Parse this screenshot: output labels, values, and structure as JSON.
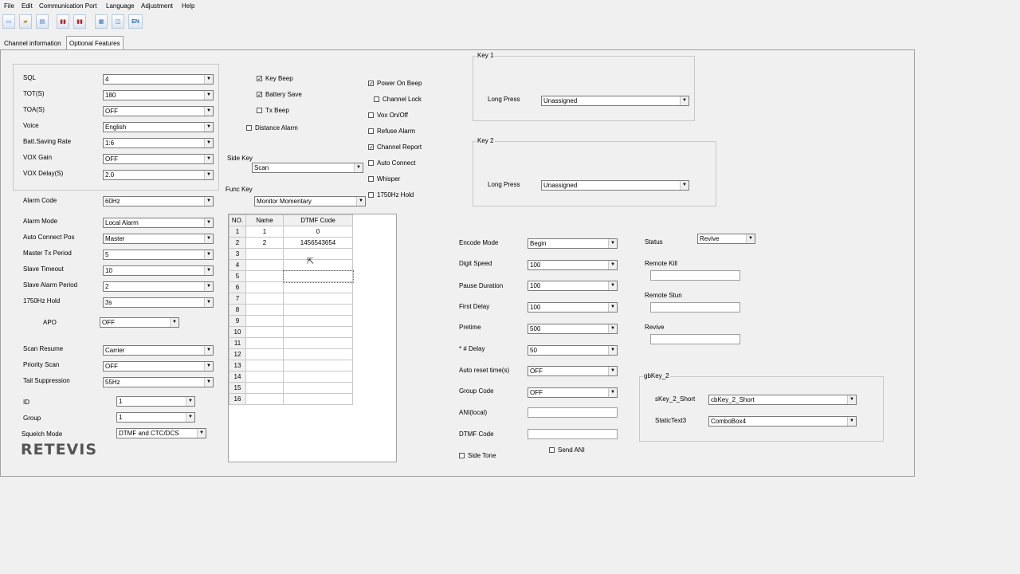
{
  "menu": [
    "File",
    "Edit",
    "Communication Port",
    "Language",
    "Adjustment",
    "Help"
  ],
  "toolbar": {
    "icons": [
      "new-icon",
      "open-icon",
      "save-icon",
      "read-icon",
      "write-icon",
      "info-icon",
      "settings-icon"
    ],
    "en_label": "EN"
  },
  "tabs": [
    "Channel information",
    "Optional Features"
  ],
  "left": {
    "sql": {
      "label": "SQL",
      "value": "4"
    },
    "tot": {
      "label": "TOT(S)",
      "value": "180"
    },
    "toa": {
      "label": "TOA(S)",
      "value": "OFF"
    },
    "voice": {
      "label": "Voice",
      "value": "English"
    },
    "batt": {
      "label": "Batt.Saving Rate",
      "value": "1:6"
    },
    "voxgain": {
      "label": "VOX Gain",
      "value": "OFF"
    },
    "voxdelay": {
      "label": "VOX Delay(S)",
      "value": "2.0"
    },
    "alarmcode": {
      "label": "Alarm Code",
      "value": "60Hz"
    },
    "alarmmode": {
      "label": "Alarm Mode",
      "value": "Local Alarm"
    },
    "autoconn": {
      "label": "Auto Connect Pos",
      "value": "Master"
    },
    "mastertx": {
      "label": "Master Tx Period",
      "value": "5"
    },
    "slavetimeout": {
      "label": "Slave Timeout",
      "value": "10"
    },
    "slavealarm": {
      "label": "Slave Alarm Period",
      "value": "2"
    },
    "hold1750": {
      "label": "1750Hz Hold",
      "value": "3s"
    },
    "apo": {
      "label": "APO",
      "value": "OFF"
    },
    "scanresume": {
      "label": "Scan Resume",
      "value": "Carrier"
    },
    "priority": {
      "label": "Priority Scan",
      "value": "OFF"
    },
    "tail": {
      "label": "Tail Suppression",
      "value": "55Hz"
    },
    "id": {
      "label": "ID",
      "value": "1"
    },
    "group": {
      "label": "Group",
      "value": "1"
    },
    "squelch": {
      "label": "Squelch Mode",
      "value": "DTMF and CTC/DCS"
    },
    "logo": "RETEVIS"
  },
  "mid": {
    "keybeep": {
      "label": "Key Beep",
      "checked": true
    },
    "battsave": {
      "label": "Battery Save",
      "checked": true
    },
    "txbeep": {
      "label": "Tx Beep",
      "checked": false
    },
    "distalarm": {
      "label": "Distance Alarm",
      "checked": false
    },
    "sidekey": {
      "label": "Side Key",
      "value": "Scan"
    },
    "funckey": {
      "label": "Func Key",
      "value": "Monitor Momentary"
    },
    "poweron": {
      "label": "Power On Beep",
      "checked": true
    },
    "chlock": {
      "label": "Channel Lock",
      "checked": false
    },
    "vox": {
      "label": "Vox On/Off",
      "checked": false
    },
    "refuse": {
      "label": "Refuse Alarm",
      "checked": false
    },
    "chreport": {
      "label": "Channel Report",
      "checked": true
    },
    "autoconnect": {
      "label": "Auto Connect",
      "checked": false
    },
    "whisper": {
      "label": "Whisper",
      "checked": false
    },
    "hold": {
      "label": "1750Hz Hold",
      "checked": false
    }
  },
  "grid": {
    "headers": [
      "NO.",
      "Name",
      "DTMF Code"
    ],
    "rows": [
      [
        "1",
        "1",
        "0"
      ],
      [
        "2",
        "2",
        "1456543654"
      ],
      [
        "3",
        "",
        ""
      ],
      [
        "4",
        "",
        ""
      ],
      [
        "5",
        "",
        ""
      ],
      [
        "6",
        "",
        ""
      ],
      [
        "7",
        "",
        ""
      ],
      [
        "8",
        "",
        ""
      ],
      [
        "9",
        "",
        ""
      ],
      [
        "10",
        "",
        ""
      ],
      [
        "11",
        "",
        ""
      ],
      [
        "12",
        "",
        ""
      ],
      [
        "13",
        "",
        ""
      ],
      [
        "14",
        "",
        ""
      ],
      [
        "15",
        "",
        ""
      ],
      [
        "16",
        "",
        ""
      ]
    ]
  },
  "key1": {
    "title": "Key 1",
    "label": "Long Press",
    "value": "Unassigned"
  },
  "key2": {
    "title": "Key 2",
    "label": "Long Press",
    "value": "Unassigned"
  },
  "dtmf": {
    "encode": {
      "label": "Encode Mode",
      "value": "Begin"
    },
    "digit": {
      "label": "Digit Speed",
      "value": "100"
    },
    "pause": {
      "label": "Pause Duration",
      "value": "100"
    },
    "first": {
      "label": "First Delay",
      "value": "100"
    },
    "pretime": {
      "label": "Pretime",
      "value": "500"
    },
    "hash": {
      "label": "* # Delay",
      "value": "50"
    },
    "autoreset": {
      "label": "Auto reset time(s)",
      "value": "OFF"
    },
    "groupcode": {
      "label": "Group Code",
      "value": "OFF"
    },
    "ani": {
      "label": "ANI(local)",
      "value": ""
    },
    "dtmfcode": {
      "label": "DTMF Code",
      "value": ""
    },
    "sidetone": {
      "label": "Side Tone",
      "checked": false
    },
    "sendani": {
      "label": "Send ANI",
      "checked": false
    }
  },
  "right": {
    "status": {
      "label": "Status",
      "value": "Revive"
    },
    "kill": {
      "label": "Remote Kill",
      "value": ""
    },
    "stun": {
      "label": "Remote Stun",
      "value": ""
    },
    "revive": {
      "label": "Revive",
      "value": ""
    }
  },
  "gbkey2": {
    "title": "gbKey_2",
    "short_label": "sKey_2_Short",
    "short_value": "cbKey_2_Short",
    "static_label": "StaticText3",
    "static_value": "ComboBox4"
  }
}
